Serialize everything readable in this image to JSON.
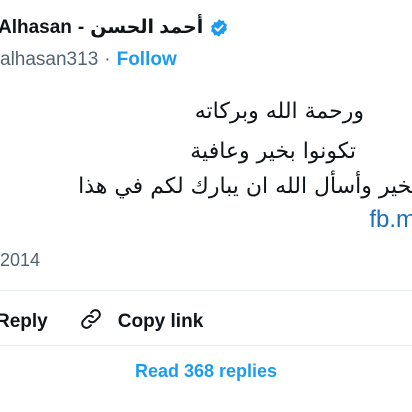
{
  "author": {
    "name_latin": "Alhasan",
    "name_separator": "-",
    "name_arabic": "أحمد الحسن",
    "handle": "alhasan313",
    "separator": "·",
    "follow_label": "Follow",
    "verified_icon": "verified-badge-icon",
    "verified_color": "#1d9bf0"
  },
  "tweet": {
    "lines": [
      "ورحمة الله وبركاته",
      "تكونوا بخير وعافية",
      "بخير وأسأل الله ان يبارك لكم في هذا"
    ],
    "link_text": "fb.m",
    "date": "2014"
  },
  "actions": {
    "reply_label": "Reply",
    "copy_link_label": "Copy link",
    "copy_link_icon": "link-icon",
    "read_replies_label": "Read 368 replies"
  },
  "colors": {
    "accent": "#1d9bf0",
    "text": "#0f1419",
    "muted": "#536471",
    "divider": "#e6ecf0"
  }
}
